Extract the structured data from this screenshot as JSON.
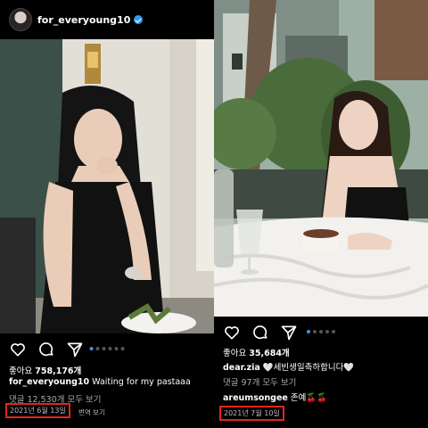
{
  "left_post": {
    "username": "for_everyoung10",
    "likes_label": "좋아요",
    "likes_count": "758,176개",
    "caption_user": "for_everyoung10",
    "caption_text": "Waiting for my pastaaa",
    "comments_link": "댓글 12,530개 모두 보기",
    "date": "2021년 6월 13일",
    "translate_label": "번역 보기"
  },
  "right_post": {
    "likes_label": "좋아요",
    "likes_count": "35,684개",
    "caption_user": "dear.zia",
    "caption_text": "🤍세빈생일축하합니다🤍",
    "comments_link": "댓글 97개 모두 보기",
    "comment_user": "areumsongee",
    "comment_text": "존예🍒🍒",
    "date": "2021년 7월 10일"
  },
  "icons": [
    "heart-icon",
    "comment-icon",
    "share-icon"
  ],
  "colors": {
    "highlight_box": "#e0261c",
    "verified": "#3897f0",
    "carousel_active": "#3897f0"
  }
}
